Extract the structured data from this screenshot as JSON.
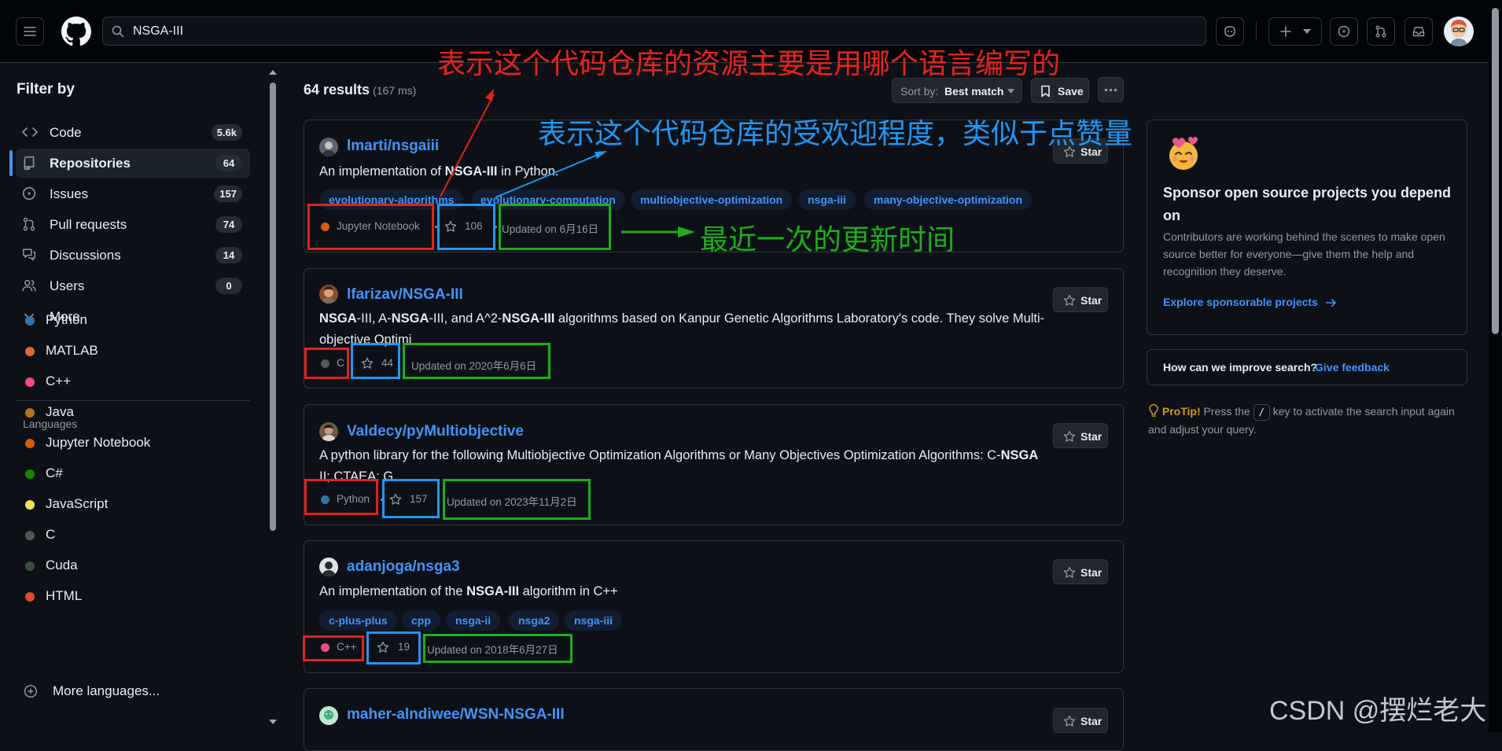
{
  "header": {
    "search_value": "NSGA-III",
    "icons": [
      "hamburger-menu-icon",
      "github-logo-icon",
      "search-icon",
      "copilot-icon",
      "plus-icon",
      "chevron-down-icon",
      "issues-icon",
      "pull-requests-icon",
      "inbox-icon",
      "user-avatar"
    ]
  },
  "sidebar": {
    "title": "Filter by",
    "items": [
      {
        "label": "Code",
        "count": "5.6k",
        "icon": "code-icon"
      },
      {
        "label": "Repositories",
        "count": "64",
        "icon": "repo-icon",
        "active": true
      },
      {
        "label": "Issues",
        "count": "157",
        "icon": "issue-opened-icon"
      },
      {
        "label": "Pull requests",
        "count": "74",
        "icon": "pull-request-icon"
      },
      {
        "label": "Discussions",
        "count": "14",
        "icon": "discussions-icon"
      },
      {
        "label": "Users",
        "count": "0",
        "icon": "people-icon"
      },
      {
        "label": "More",
        "icon": "chevron-down-icon"
      }
    ],
    "languages_heading": "Languages",
    "languages": [
      {
        "name": "Python",
        "color": "#3572A5"
      },
      {
        "name": "MATLAB",
        "color": "#e16737"
      },
      {
        "name": "C++",
        "color": "#f34b7d"
      },
      {
        "name": "Java",
        "color": "#b07219"
      },
      {
        "name": "Jupyter Notebook",
        "color": "#DA5B0B"
      },
      {
        "name": "C#",
        "color": "#178600"
      },
      {
        "name": "JavaScript",
        "color": "#f1e05a"
      },
      {
        "name": "C",
        "color": "#555555"
      },
      {
        "name": "Cuda",
        "color": "#3A4E3A"
      },
      {
        "name": "HTML",
        "color": "#e34c26"
      }
    ],
    "more_languages": "More languages..."
  },
  "results": {
    "count": "64 results",
    "time": "(167 ms)",
    "sort_prefix": "Sort by:",
    "sort_value": "Best match",
    "save_label": "Save",
    "star_label": "Star",
    "repos": [
      {
        "name": "lmarti/nsgaiii",
        "description_parts": [
          [
            "An implementation of ",
            false
          ],
          [
            "NSGA-III",
            true
          ],
          [
            " in Python.",
            false
          ]
        ],
        "topics": [
          "evolutionary-algorithms",
          "evolutionary-computation",
          "multiobjective-optimization",
          "nsga-iii",
          "many-objective-optimization"
        ],
        "language": "Jupyter Notebook",
        "language_color": "#DA5B0B",
        "stars": "106",
        "updated": "Updated on 6月16日"
      },
      {
        "name": "lfarizav/NSGA-III",
        "description_parts": [
          [
            "NSGA",
            true
          ],
          [
            "-III, A-",
            false
          ],
          [
            "NSGA",
            true
          ],
          [
            "-III, and A^2-",
            false
          ],
          [
            "NSGA-III",
            true
          ],
          [
            " algorithms based on Kanpur Genetic Algorithms Laboratory's code. They solve Multi-objective Optimi",
            false
          ]
        ],
        "language": "C",
        "language_color": "#555555",
        "stars": "44",
        "updated": "Updated on 2020年6月6日"
      },
      {
        "name": "Valdecy/pyMultiobjective",
        "description_parts": [
          [
            "A python library for the following Multiobjective Optimization Algorithms or Many Objectives Optimization Algorithms: C-",
            false
          ],
          [
            "NSGA",
            true
          ],
          [
            " II; CTAEA; G",
            false
          ]
        ],
        "language": "Python",
        "language_color": "#3572A5",
        "stars": "157",
        "updated": "Updated on 2023年11月2日"
      },
      {
        "name": "adanjoga/nsga3",
        "description_parts": [
          [
            "An implementation of the ",
            false
          ],
          [
            "NSGA-III",
            true
          ],
          [
            " algorithm in C++",
            false
          ]
        ],
        "topics": [
          "c-plus-plus",
          "cpp",
          "nsga-ii",
          "nsga2",
          "nsga-iii"
        ],
        "language": "C++",
        "language_color": "#f34b7d",
        "stars": "19",
        "updated": "Updated on 2018年6月27日"
      },
      {
        "name_prefix": "maher-alndiwee/WSN-",
        "name_highlight": "NSGA-III"
      }
    ]
  },
  "right": {
    "sponsor_title": "Sponsor open source projects you depend on",
    "sponsor_body": "Contributors are working behind the scenes to make open source better for everyone—give them the help and recognition they deserve.",
    "sponsor_link": "Explore sponsorable projects",
    "feedback_question": "How can we improve search?",
    "feedback_link": "Give feedback",
    "protip_label": "ProTip!",
    "protip_pre": "Press the",
    "protip_key": "/",
    "protip_post": "key to activate the search input again and adjust your query."
  },
  "annotations": {
    "language": "表示这个代码仓库的资源主要是用哪个语言编写的",
    "popularity": "表示这个代码仓库的受欢迎程度，类似于点赞量",
    "updated": "最近一次的更新时间",
    "colors": {
      "red": "#e0221c",
      "blue": "#2196f3",
      "green": "#1fad1a"
    }
  },
  "watermark": "CSDN @摆烂老大"
}
